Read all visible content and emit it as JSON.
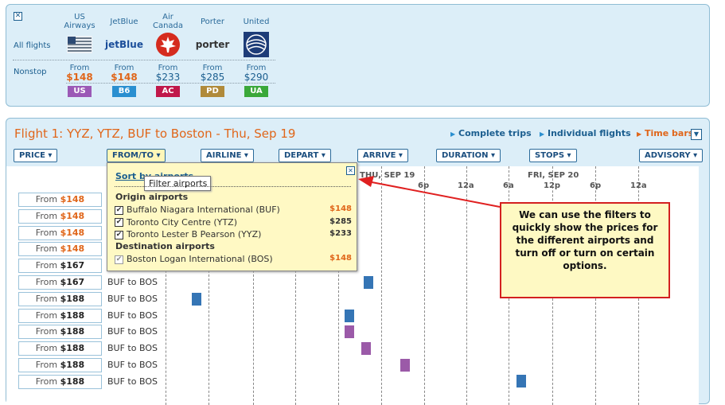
{
  "top": {
    "close_glyph": "✕",
    "row_all": "All flights",
    "row_nonstop": "Nonstop",
    "airlines": [
      {
        "name_line1": "US",
        "name_line2": "Airways",
        "from": "From",
        "price": "$148",
        "code": "US",
        "color": "#9b59b6",
        "price_color": "#e0661a",
        "logo": "us-airways-logo-icon"
      },
      {
        "name_line1": "JetBlue",
        "name_line2": "",
        "from": "From",
        "price": "$148",
        "code": "B6",
        "color": "#2a8fd0",
        "price_color": "#e0661a",
        "logo_text": "jetBlue",
        "logo": "jetblue-logo-icon"
      },
      {
        "name_line1": "Air",
        "name_line2": "Canada",
        "from": "From",
        "price": "$233",
        "code": "AC",
        "color": "#c0184a",
        "price_color": "#1b5e8f",
        "logo": "air-canada-logo-icon"
      },
      {
        "name_line1": "Porter",
        "name_line2": "",
        "from": "From",
        "price": "$285",
        "code": "PD",
        "color": "#b08a3a",
        "price_color": "#1b5e8f",
        "logo_text": "porter",
        "logo": "porter-logo-icon"
      },
      {
        "name_line1": "United",
        "name_line2": "",
        "from": "From",
        "price": "$290",
        "code": "UA",
        "color": "#3aa83a",
        "price_color": "#1b5e8f",
        "logo": "united-logo-icon"
      }
    ]
  },
  "flight": {
    "title": "Flight 1: YYZ, YTZ, BUF to Boston - Thu, Sep 19",
    "link_complete": "Complete trips",
    "link_individual": "Individual flights",
    "link_timebars": "Time bars",
    "filters": [
      "PRICE",
      "FROM/TO",
      "AIRLINE",
      "DEPART",
      "ARRIVE",
      "DURATION",
      "STOPS",
      "ADVISORY"
    ],
    "day_labels": [
      "THU, SEP 19",
      "FRI, SEP 20"
    ],
    "time_labels": [
      "6p",
      "12a",
      "6a",
      "12p",
      "6p",
      "12a"
    ]
  },
  "rows": [
    {
      "from": "From",
      "price": "$148",
      "price_color": "#e0661a",
      "route": ""
    },
    {
      "from": "From",
      "price": "$148",
      "price_color": "#e0661a",
      "route": ""
    },
    {
      "from": "From",
      "price": "$148",
      "price_color": "#e0661a",
      "route": ""
    },
    {
      "from": "From",
      "price": "$148",
      "price_color": "#e0661a",
      "route": ""
    },
    {
      "from": "From",
      "price": "$167",
      "price_color": "#222222",
      "route": ""
    },
    {
      "from": "From",
      "price": "$167",
      "price_color": "#222222",
      "route": "BUF to BOS"
    },
    {
      "from": "From",
      "price": "$188",
      "price_color": "#222222",
      "route": "BUF to BOS"
    },
    {
      "from": "From",
      "price": "$188",
      "price_color": "#222222",
      "route": "BUF to BOS"
    },
    {
      "from": "From",
      "price": "$188",
      "price_color": "#222222",
      "route": "BUF to BOS"
    },
    {
      "from": "From",
      "price": "$188",
      "price_color": "#222222",
      "route": "BUF to BOS"
    },
    {
      "from": "From",
      "price": "$188",
      "price_color": "#222222",
      "route": "BUF to BOS"
    },
    {
      "from": "From",
      "price": "$188",
      "price_color": "#222222",
      "route": "BUF to BOS"
    }
  ],
  "popup": {
    "sort_link": "Sort by airports",
    "tooltip": "Filter airports",
    "close_glyph": "✕",
    "origin_header": "Origin airports",
    "origins": [
      {
        "name": "Buffalo Niagara International (BUF)",
        "price": "$148",
        "price_color": "#e0661a"
      },
      {
        "name": "Toronto City Centre (YTZ)",
        "price": "$285",
        "price_color": "#333333"
      },
      {
        "name": "Toronto Lester B Pearson (YYZ)",
        "price": "$233",
        "price_color": "#333333"
      }
    ],
    "dest_header": "Destination airports",
    "dests": [
      {
        "name": "Boston Logan International (BOS)",
        "price": "$148",
        "price_color": "#e0661a"
      }
    ]
  },
  "callout": {
    "text": "We can use the filters to quickly show the prices for the different airports and turn off or turn on certain options."
  }
}
